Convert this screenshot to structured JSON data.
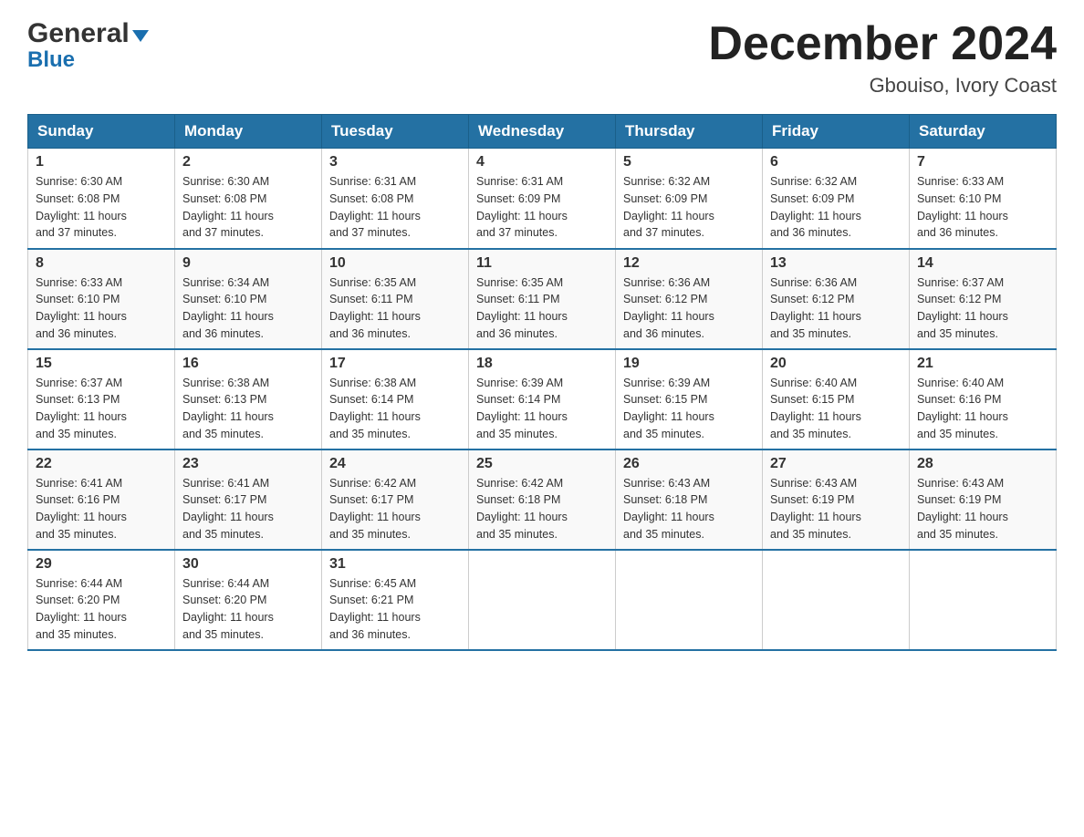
{
  "logo": {
    "line1_text": "General",
    "arrow": "▼",
    "line2_text": "Blue"
  },
  "header": {
    "month": "December 2024",
    "location": "Gbouiso, Ivory Coast"
  },
  "weekdays": [
    "Sunday",
    "Monday",
    "Tuesday",
    "Wednesday",
    "Thursday",
    "Friday",
    "Saturday"
  ],
  "weeks": [
    [
      {
        "day": "1",
        "sunrise": "6:30 AM",
        "sunset": "6:08 PM",
        "daylight": "11 hours and 37 minutes."
      },
      {
        "day": "2",
        "sunrise": "6:30 AM",
        "sunset": "6:08 PM",
        "daylight": "11 hours and 37 minutes."
      },
      {
        "day": "3",
        "sunrise": "6:31 AM",
        "sunset": "6:08 PM",
        "daylight": "11 hours and 37 minutes."
      },
      {
        "day": "4",
        "sunrise": "6:31 AM",
        "sunset": "6:09 PM",
        "daylight": "11 hours and 37 minutes."
      },
      {
        "day": "5",
        "sunrise": "6:32 AM",
        "sunset": "6:09 PM",
        "daylight": "11 hours and 37 minutes."
      },
      {
        "day": "6",
        "sunrise": "6:32 AM",
        "sunset": "6:09 PM",
        "daylight": "11 hours and 36 minutes."
      },
      {
        "day": "7",
        "sunrise": "6:33 AM",
        "sunset": "6:10 PM",
        "daylight": "11 hours and 36 minutes."
      }
    ],
    [
      {
        "day": "8",
        "sunrise": "6:33 AM",
        "sunset": "6:10 PM",
        "daylight": "11 hours and 36 minutes."
      },
      {
        "day": "9",
        "sunrise": "6:34 AM",
        "sunset": "6:10 PM",
        "daylight": "11 hours and 36 minutes."
      },
      {
        "day": "10",
        "sunrise": "6:35 AM",
        "sunset": "6:11 PM",
        "daylight": "11 hours and 36 minutes."
      },
      {
        "day": "11",
        "sunrise": "6:35 AM",
        "sunset": "6:11 PM",
        "daylight": "11 hours and 36 minutes."
      },
      {
        "day": "12",
        "sunrise": "6:36 AM",
        "sunset": "6:12 PM",
        "daylight": "11 hours and 36 minutes."
      },
      {
        "day": "13",
        "sunrise": "6:36 AM",
        "sunset": "6:12 PM",
        "daylight": "11 hours and 35 minutes."
      },
      {
        "day": "14",
        "sunrise": "6:37 AM",
        "sunset": "6:12 PM",
        "daylight": "11 hours and 35 minutes."
      }
    ],
    [
      {
        "day": "15",
        "sunrise": "6:37 AM",
        "sunset": "6:13 PM",
        "daylight": "11 hours and 35 minutes."
      },
      {
        "day": "16",
        "sunrise": "6:38 AM",
        "sunset": "6:13 PM",
        "daylight": "11 hours and 35 minutes."
      },
      {
        "day": "17",
        "sunrise": "6:38 AM",
        "sunset": "6:14 PM",
        "daylight": "11 hours and 35 minutes."
      },
      {
        "day": "18",
        "sunrise": "6:39 AM",
        "sunset": "6:14 PM",
        "daylight": "11 hours and 35 minutes."
      },
      {
        "day": "19",
        "sunrise": "6:39 AM",
        "sunset": "6:15 PM",
        "daylight": "11 hours and 35 minutes."
      },
      {
        "day": "20",
        "sunrise": "6:40 AM",
        "sunset": "6:15 PM",
        "daylight": "11 hours and 35 minutes."
      },
      {
        "day": "21",
        "sunrise": "6:40 AM",
        "sunset": "6:16 PM",
        "daylight": "11 hours and 35 minutes."
      }
    ],
    [
      {
        "day": "22",
        "sunrise": "6:41 AM",
        "sunset": "6:16 PM",
        "daylight": "11 hours and 35 minutes."
      },
      {
        "day": "23",
        "sunrise": "6:41 AM",
        "sunset": "6:17 PM",
        "daylight": "11 hours and 35 minutes."
      },
      {
        "day": "24",
        "sunrise": "6:42 AM",
        "sunset": "6:17 PM",
        "daylight": "11 hours and 35 minutes."
      },
      {
        "day": "25",
        "sunrise": "6:42 AM",
        "sunset": "6:18 PM",
        "daylight": "11 hours and 35 minutes."
      },
      {
        "day": "26",
        "sunrise": "6:43 AM",
        "sunset": "6:18 PM",
        "daylight": "11 hours and 35 minutes."
      },
      {
        "day": "27",
        "sunrise": "6:43 AM",
        "sunset": "6:19 PM",
        "daylight": "11 hours and 35 minutes."
      },
      {
        "day": "28",
        "sunrise": "6:43 AM",
        "sunset": "6:19 PM",
        "daylight": "11 hours and 35 minutes."
      }
    ],
    [
      {
        "day": "29",
        "sunrise": "6:44 AM",
        "sunset": "6:20 PM",
        "daylight": "11 hours and 35 minutes."
      },
      {
        "day": "30",
        "sunrise": "6:44 AM",
        "sunset": "6:20 PM",
        "daylight": "11 hours and 35 minutes."
      },
      {
        "day": "31",
        "sunrise": "6:45 AM",
        "sunset": "6:21 PM",
        "daylight": "11 hours and 36 minutes."
      },
      null,
      null,
      null,
      null
    ]
  ],
  "labels": {
    "sunrise": "Sunrise:",
    "sunset": "Sunset:",
    "daylight": "Daylight:"
  }
}
